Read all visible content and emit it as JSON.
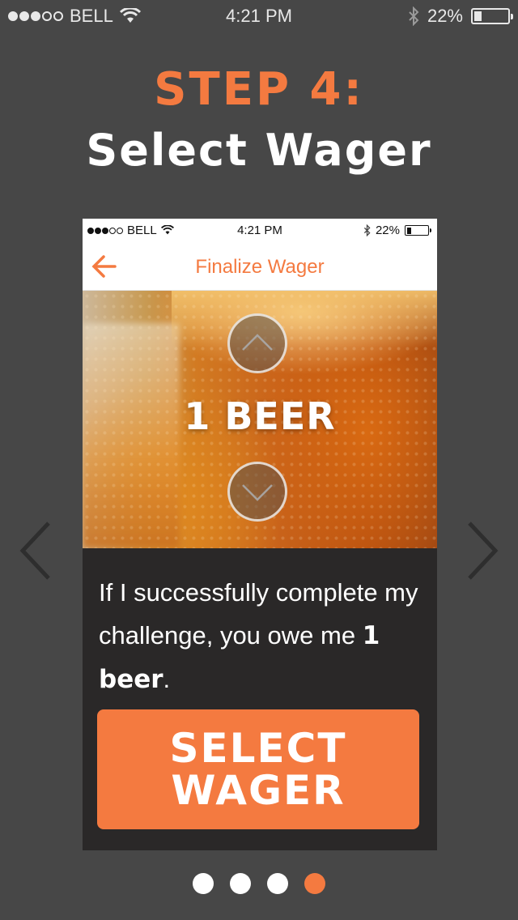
{
  "status_bar": {
    "carrier": "BELL",
    "time": "4:21 PM",
    "battery": "22%",
    "battery_level": 0.22
  },
  "heading": {
    "step": "STEP 4:",
    "title": "Select Wager"
  },
  "inner_phone": {
    "status_bar": {
      "carrier": "BELL",
      "time": "4:21 PM",
      "battery": "22%",
      "battery_level": 0.22
    },
    "navbar": {
      "title": "Finalize Wager",
      "back_icon": "left-arrow-icon"
    },
    "wager": {
      "amount": "1 BEER",
      "increase_icon": "chevron-up-icon",
      "decrease_icon": "chevron-down-icon"
    },
    "description": {
      "text": "If I successfully complete my challenge, you owe me ",
      "bold": "1 beer",
      "suffix": "."
    },
    "select_button": "SELECT WAGER"
  },
  "carousel": {
    "prev_icon": "chevron-left-icon",
    "next_icon": "chevron-right-icon",
    "pages": 4,
    "active_page": 4
  },
  "colors": {
    "accent": "#f47a40",
    "background": "#474747",
    "panel": "#2a2828"
  }
}
